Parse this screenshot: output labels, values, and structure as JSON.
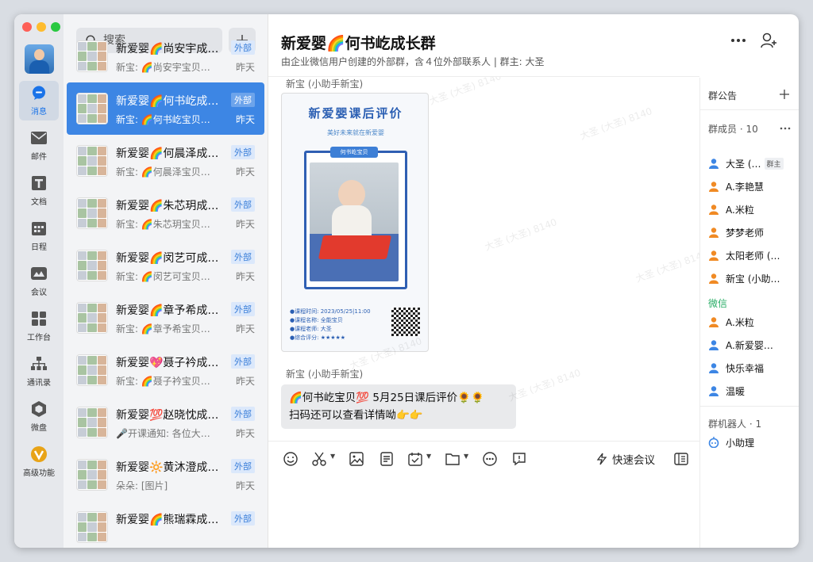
{
  "nav": {
    "items": [
      {
        "label": "消息",
        "icon": "message-icon"
      },
      {
        "label": "邮件",
        "icon": "mail-icon"
      },
      {
        "label": "文档",
        "icon": "document-icon"
      },
      {
        "label": "日程",
        "icon": "calendar-icon"
      },
      {
        "label": "会议",
        "icon": "meeting-icon"
      },
      {
        "label": "工作台",
        "icon": "workbench-icon"
      },
      {
        "label": "通讯录",
        "icon": "contacts-icon"
      },
      {
        "label": "微盘",
        "icon": "drive-icon"
      },
      {
        "label": "高级功能",
        "icon": "advanced-icon"
      }
    ]
  },
  "search": {
    "placeholder": "搜索"
  },
  "chats": [
    {
      "title": "新爱婴🌈尚安宇成…",
      "badge": "外部",
      "sub": "新宝: 🌈尚安宇宝贝…",
      "time": "昨天"
    },
    {
      "title": "新爱婴🌈何书屹成…",
      "badge": "外部",
      "sub": "新宝: 🌈何书屹宝贝…",
      "time": "昨天"
    },
    {
      "title": "新爱婴🌈何晨泽成…",
      "badge": "外部",
      "sub": "新宝: 🌈何晨泽宝贝…",
      "time": "昨天"
    },
    {
      "title": "新爱婴🌈朱芯玥成…",
      "badge": "外部",
      "sub": "新宝: 🌈朱芯玥宝贝…",
      "time": "昨天"
    },
    {
      "title": "新爱婴🌈闵艺可成…",
      "badge": "外部",
      "sub": "新宝: 🌈闵艺可宝贝…",
      "time": "昨天"
    },
    {
      "title": "新爱婴🌈章予希成…",
      "badge": "外部",
      "sub": "新宝: 🌈章予希宝贝…",
      "time": "昨天"
    },
    {
      "title": "新爱婴💖聂子衿成…",
      "badge": "外部",
      "sub": "新宝: 🌈聂子衿宝贝…",
      "time": "昨天"
    },
    {
      "title": "新爱婴💯赵晓忱成…",
      "badge": "外部",
      "sub": "🎤开课通知: 各位大…",
      "time": "昨天"
    },
    {
      "title": "新爱婴🔆黄沐澄成…",
      "badge": "外部",
      "sub": "朵朵: [图片]",
      "time": "昨天"
    },
    {
      "title": "新爱婴🌈熊瑞霖成…",
      "badge": "外部",
      "sub": "",
      "time": ""
    }
  ],
  "header": {
    "title": "新爱婴🌈何书屹成长群",
    "subtitle": "由企业微信用户创建的外部群，含４位外部联系人 | 群主: 大圣"
  },
  "messages": {
    "sender1": "新宝 (小助手新宝)",
    "sender2": "新宝 (小助手新宝)",
    "bubble_line1": "🌈何书屹宝贝💯 5月25日课后评价🌻🌻",
    "bubble_line2": "扫码还可以查看详情呦👉👉"
  },
  "poster": {
    "title": "新爱婴课后评价",
    "subtitle": "美好未来就在新爱婴",
    "card_header": "何书屹宝贝",
    "info": [
      "●课程时间: 2023/05/25|11:00",
      "●课程名称: 全能宝贝",
      "●课程老师: 大圣",
      "●综合评分: ★★★★★"
    ]
  },
  "watermark": "大圣 (大圣) 8140",
  "toolbar": {
    "quick_meeting": "快速会议"
  },
  "side": {
    "announcement": "群公告",
    "members_header": "群成员 · 10",
    "owner_badge": "群主",
    "members": [
      "大圣 (…",
      "A.李艳慧",
      "A.米粒",
      "梦梦老师",
      "太阳老师 (…",
      "新宝 (小助…"
    ],
    "wechat_header": "微信",
    "wechat_members": [
      "A.米粒",
      "A.新爱婴…",
      "快乐幸福",
      "温暖"
    ],
    "robots_header": "群机器人 · 1",
    "robot": "小助理"
  },
  "colors": {
    "accent": "#3d86e4",
    "external_badge": "#3b7fd9",
    "member_icon_orange": "#f08a24",
    "member_icon_blue": "#3d86e4"
  }
}
